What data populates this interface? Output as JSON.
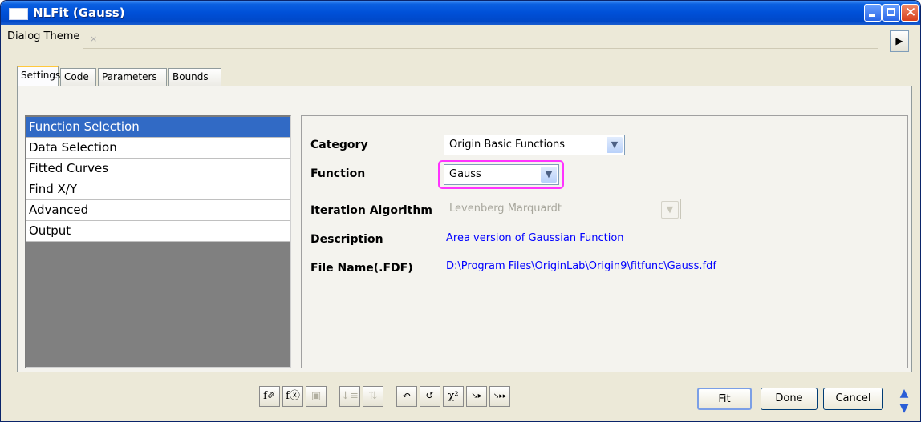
{
  "window": {
    "title": "NLFit (Gauss)"
  },
  "theme": {
    "label": "Dialog Theme",
    "value": "×"
  },
  "tabs": [
    {
      "label": "Settings"
    },
    {
      "label": "Code"
    },
    {
      "label": "Parameters"
    },
    {
      "label": "Bounds"
    }
  ],
  "nav": [
    {
      "label": "Function Selection"
    },
    {
      "label": "Data Selection"
    },
    {
      "label": "Fitted Curves"
    },
    {
      "label": "Find X/Y"
    },
    {
      "label": "Advanced"
    },
    {
      "label": "Output"
    }
  ],
  "form": {
    "category": {
      "label": "Category",
      "value": "Origin Basic Functions"
    },
    "function": {
      "label": "Function",
      "value": "Gauss"
    },
    "iteration": {
      "label": "Iteration Algorithm",
      "value": "Levenberg Marquardt"
    },
    "description": {
      "label": "Description",
      "value": "Area version of Gaussian Function"
    },
    "filename": {
      "label": "File Name(.FDF)",
      "value": "D:\\Program Files\\OriginLab\\Origin9\\fitfunc\\Gauss.fdf"
    }
  },
  "toolbar": [
    {
      "icon": "fx-edit-icon",
      "glyph": "f✐"
    },
    {
      "icon": "fx-new-icon",
      "glyph": "fⓧ"
    },
    {
      "icon": "save-icon",
      "glyph": "▣"
    },
    {
      "icon": "sort-down-icon",
      "glyph": "↓≡"
    },
    {
      "icon": "sort-both-icon",
      "glyph": "⇅"
    },
    {
      "icon": "one-iteration-icon",
      "glyph": "↶"
    },
    {
      "icon": "fit-until-converged-icon",
      "glyph": "↺"
    },
    {
      "icon": "chi-square-icon",
      "glyph": "χ²"
    },
    {
      "icon": "fit-next-icon",
      "glyph": "↘▸"
    },
    {
      "icon": "fit-all-icon",
      "glyph": "↘▸▸"
    }
  ],
  "buttons": {
    "fit": "Fit",
    "done": "Done",
    "cancel": "Cancel"
  },
  "colors": {
    "highlight": "#ff33ff",
    "value_text": "#0000ff",
    "selection": "#316ac5"
  }
}
